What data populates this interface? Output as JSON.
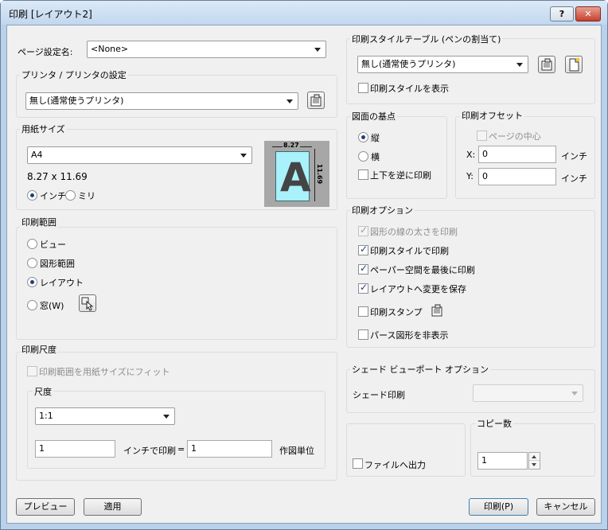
{
  "title": "印刷 [レイアウト2]",
  "titlebar": {
    "help": "?",
    "close": "✕"
  },
  "page_setup": {
    "label": "ページ設定名:",
    "value": "<None>"
  },
  "printer": {
    "group": "プリンタ / プリンタの設定",
    "value": "無し(通常使うプリンタ)"
  },
  "paper": {
    "group": "用紙サイズ",
    "value": "A4",
    "dims": "8.27 x 11.69",
    "unit_inch": "インチ",
    "unit_mm": "ミリ",
    "preview_w": "8.27",
    "preview_h": "11.69",
    "preview_letter": "A"
  },
  "area": {
    "group": "印刷範囲",
    "options": [
      "ビュー",
      "図形範囲",
      "レイアウト",
      "窓(W)"
    ]
  },
  "scale": {
    "group": "印刷尺度",
    "fit": "印刷範囲を用紙サイズにフィット",
    "sub": "尺度",
    "value": "1:1",
    "num": "1",
    "inch_lbl": "インチで印刷",
    "eq": "=",
    "units": "1",
    "units_lbl": "作図単位"
  },
  "style_table": {
    "group": "印刷スタイルテーブル (ペンの割当て)",
    "value": "無し(通常使うプリンタ)",
    "show": "印刷スタイルを表示"
  },
  "base": {
    "group": "図面の基点",
    "portrait": "縦",
    "landscape": "横",
    "flip": "上下を逆に印刷"
  },
  "offset": {
    "group": "印刷オフセット",
    "center": "ページの中心",
    "x_lbl": "X:",
    "x": "0",
    "y_lbl": "Y:",
    "y": "0",
    "unit": "インチ"
  },
  "options": {
    "group": "印刷オプション",
    "items": [
      "図形の線の太さを印刷",
      "印刷スタイルで印刷",
      "ペーパー空間を最後に印刷",
      "レイアウトへ変更を保存",
      "印刷スタンプ",
      "パース図形を非表示"
    ]
  },
  "shade": {
    "group": "シェード ビューポート オプション",
    "label": "シェード印刷",
    "value": ""
  },
  "file_out": "ファイルへ出力",
  "copies": {
    "group": "コピー数",
    "value": "1"
  },
  "buttons": {
    "preview": "プレビュー",
    "apply": "適用",
    "print": "印刷(P)",
    "cancel": "キャンセル"
  }
}
